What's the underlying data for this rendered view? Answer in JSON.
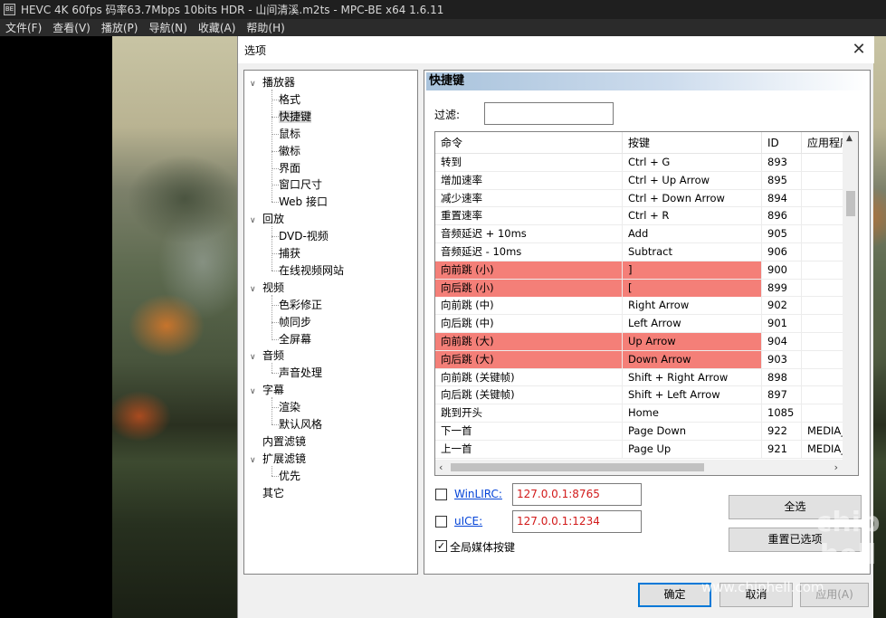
{
  "window": {
    "title": "HEVC 4K 60fps 码率63.7Mbps 10bits HDR - 山间清溪.m2ts - MPC-BE x64 1.6.11",
    "icon_text": "BE"
  },
  "menu": [
    "文件(F)",
    "查看(V)",
    "播放(P)",
    "导航(N)",
    "收藏(A)",
    "帮助(H)"
  ],
  "dialog": {
    "title": "选项",
    "close_glyph": "✕",
    "tree": [
      {
        "label": "播放器",
        "level": 0,
        "expanded": true
      },
      {
        "label": "格式",
        "level": 1
      },
      {
        "label": "快捷键",
        "level": 1,
        "selected": true
      },
      {
        "label": "鼠标",
        "level": 1
      },
      {
        "label": "徽标",
        "level": 1
      },
      {
        "label": "界面",
        "level": 1
      },
      {
        "label": "窗口尺寸",
        "level": 1
      },
      {
        "label": "Web 接口",
        "level": 1
      },
      {
        "label": "回放",
        "level": 0,
        "expanded": true
      },
      {
        "label": "DVD-视频",
        "level": 1
      },
      {
        "label": "捕获",
        "level": 1
      },
      {
        "label": "在线视频网站",
        "level": 1
      },
      {
        "label": "视频",
        "level": 0,
        "expanded": true
      },
      {
        "label": "色彩修正",
        "level": 1
      },
      {
        "label": "帧同步",
        "level": 1
      },
      {
        "label": "全屏幕",
        "level": 1
      },
      {
        "label": "音频",
        "level": 0,
        "expanded": true
      },
      {
        "label": "声音处理",
        "level": 1
      },
      {
        "label": "字幕",
        "level": 0,
        "expanded": true
      },
      {
        "label": "渲染",
        "level": 1
      },
      {
        "label": "默认风格",
        "level": 1
      },
      {
        "label": "内置滤镜",
        "level": 0
      },
      {
        "label": "扩展滤镜",
        "level": 0,
        "expanded": true
      },
      {
        "label": "优先",
        "level": 1
      },
      {
        "label": "其它",
        "level": 0
      }
    ],
    "panel_title": "快捷键",
    "filter_label": "过滤:",
    "filter_value": "",
    "columns": [
      "命令",
      "按键",
      "ID",
      "应用程序"
    ],
    "rows": [
      {
        "cmd": "转到",
        "key": "Ctrl + G",
        "id": "893",
        "app": "",
        "hl": false
      },
      {
        "cmd": "增加速率",
        "key": "Ctrl + Up Arrow",
        "id": "895",
        "app": "",
        "hl": false
      },
      {
        "cmd": "减少速率",
        "key": "Ctrl + Down Arrow",
        "id": "894",
        "app": "",
        "hl": false
      },
      {
        "cmd": "重置速率",
        "key": "Ctrl + R",
        "id": "896",
        "app": "",
        "hl": false
      },
      {
        "cmd": "音频延迟 + 10ms",
        "key": "Add",
        "id": "905",
        "app": "",
        "hl": false
      },
      {
        "cmd": "音频延迟 - 10ms",
        "key": "Subtract",
        "id": "906",
        "app": "",
        "hl": false
      },
      {
        "cmd": "向前跳 (小)",
        "key": "]",
        "id": "900",
        "app": "",
        "hl": true
      },
      {
        "cmd": "向后跳 (小)",
        "key": "[",
        "id": "899",
        "app": "",
        "hl": true
      },
      {
        "cmd": "向前跳 (中)",
        "key": "Right Arrow",
        "id": "902",
        "app": "",
        "hl": false
      },
      {
        "cmd": "向后跳 (中)",
        "key": "Left Arrow",
        "id": "901",
        "app": "",
        "hl": false
      },
      {
        "cmd": "向前跳 (大)",
        "key": "Up Arrow",
        "id": "904",
        "app": "",
        "hl": true
      },
      {
        "cmd": "向后跳 (大)",
        "key": "Down Arrow",
        "id": "903",
        "app": "",
        "hl": true
      },
      {
        "cmd": "向前跳 (关键帧)",
        "key": "Shift + Right Arrow",
        "id": "898",
        "app": "",
        "hl": false
      },
      {
        "cmd": "向后跳 (关键帧)",
        "key": "Shift + Left Arrow",
        "id": "897",
        "app": "",
        "hl": false
      },
      {
        "cmd": "跳到开头",
        "key": "Home",
        "id": "1085",
        "app": "",
        "hl": false
      },
      {
        "cmd": "下一首",
        "key": "Page Down",
        "id": "922",
        "app": "MEDIA_",
        "hl": false
      },
      {
        "cmd": "上一首",
        "key": "Page Up",
        "id": "921",
        "app": "MEDIA_",
        "hl": false
      }
    ],
    "highlight_color": "#f47f78",
    "winlirc": {
      "label": "WinLIRC:",
      "address": "127.0.0.1:8765",
      "checked": false
    },
    "uice": {
      "label": "uICE:",
      "address": "127.0.0.1:1234",
      "checked": false
    },
    "global_media_keys": {
      "label": "全局媒体按键",
      "checked": true
    },
    "btn_select_all": "全选",
    "btn_reset": "重置已选项",
    "btn_ok": "确定",
    "btn_cancel": "取消",
    "btn_apply": "应用(A)"
  },
  "watermark": {
    "logo_text": "chip hell",
    "url": "www.chiphell.com"
  }
}
